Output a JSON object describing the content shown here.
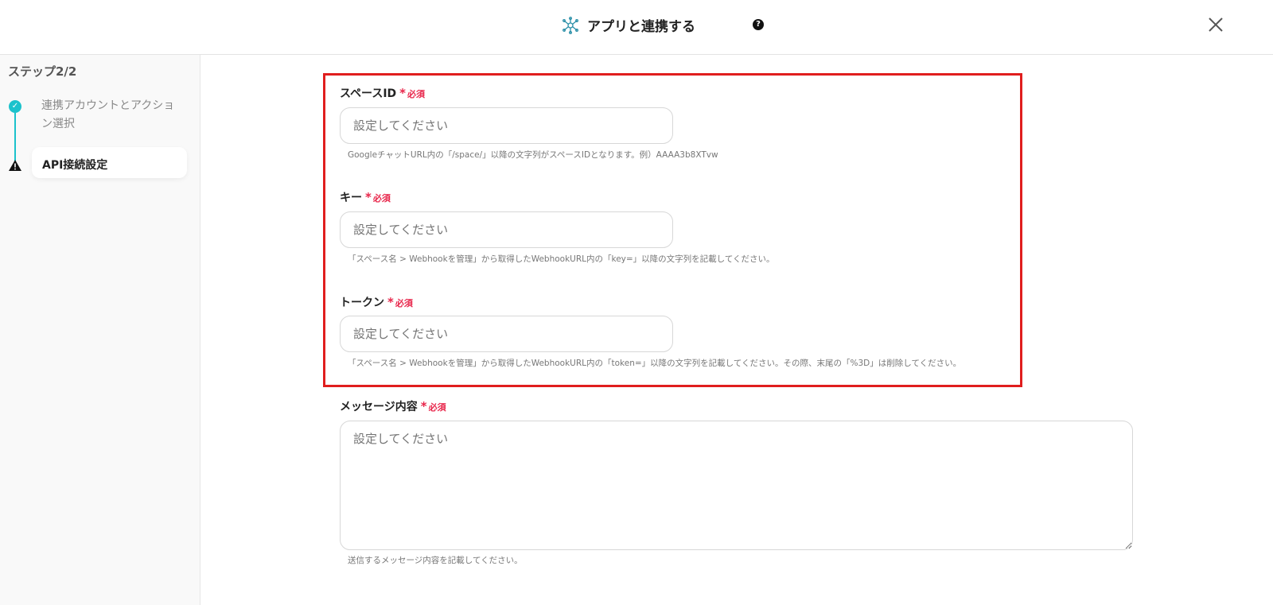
{
  "header": {
    "title": "アプリと連携する",
    "help_glyph": "?"
  },
  "sidebar": {
    "step": "ステップ2/2",
    "steps": [
      {
        "label": "連携アカウントとアクション選択",
        "status": "done"
      },
      {
        "label": "API接続設定",
        "status": "warning"
      }
    ]
  },
  "required_mark": "必須",
  "fields": [
    {
      "label": "スペースID",
      "placeholder": "設定してください",
      "hint": "GoogleチャットURL内の「/space/」以降の文字列がスペースIDとなります。例）AAAA3b8XTvw"
    },
    {
      "label": "キー",
      "placeholder": "設定してください",
      "hint": "「スペース名 > Webhookを管理」から取得したWebhookURL内の「key=」以降の文字列を記載してください。"
    },
    {
      "label": "トークン",
      "placeholder": "設定してください",
      "hint": "「スペース名 > Webhookを管理」から取得したWebhookURL内の「token=」以降の文字列を記載してください。その際、末尾の「%3D」は削除してください。"
    },
    {
      "label": "メッセージ内容",
      "placeholder": "設定してください",
      "hint": "送信するメッセージ内容を記載してください。"
    }
  ],
  "colors": {
    "accent": "#1cc2cc",
    "highlight": "#e01e1e",
    "required": "#e8254a"
  }
}
